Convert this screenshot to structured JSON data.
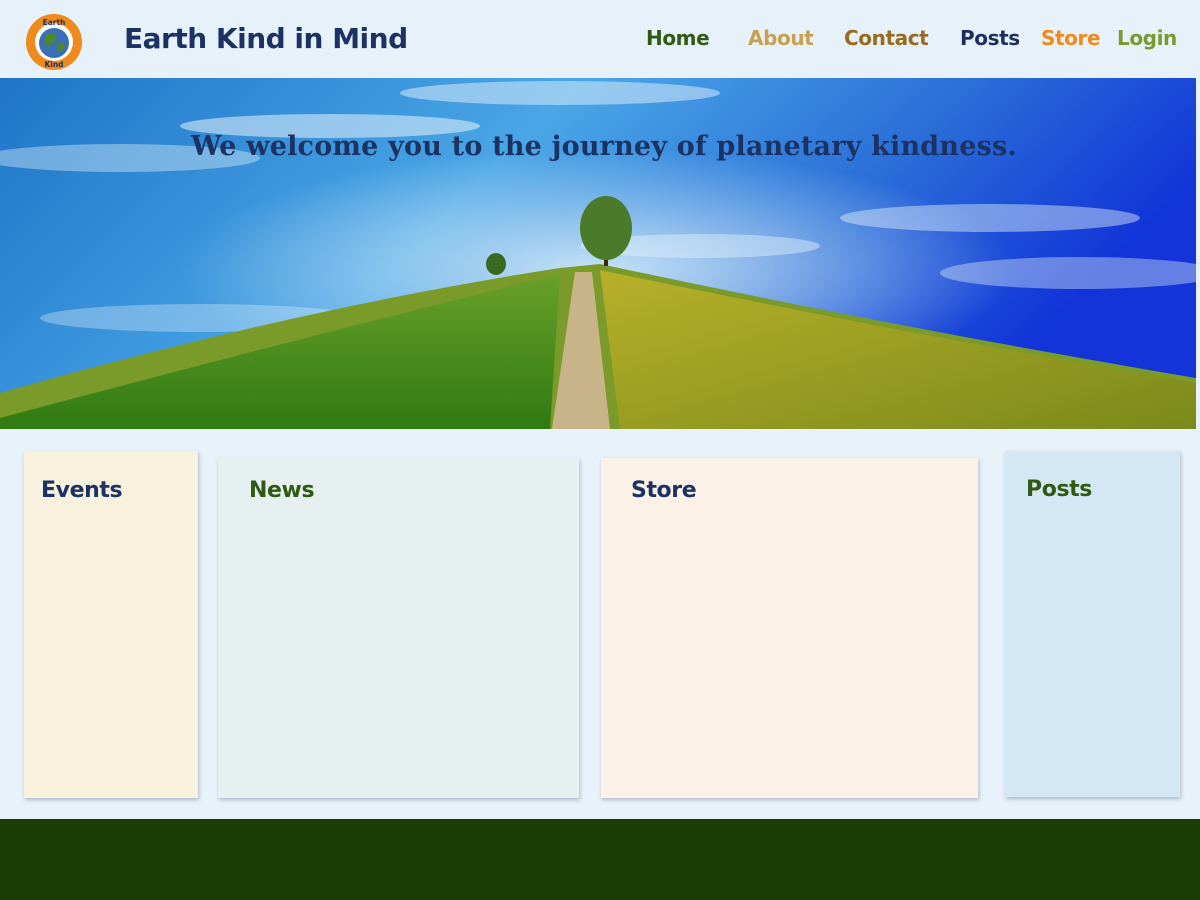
{
  "header": {
    "logo": {
      "top_text": "Earth",
      "bottom_text": "Kind"
    },
    "title": "Earth Kind in Mind",
    "nav": [
      {
        "label": "Home",
        "color": "#2f5a12"
      },
      {
        "label": "About",
        "color": "#c8a050"
      },
      {
        "label": "Contact",
        "color": "#9a6a1e"
      },
      {
        "label": "Posts",
        "color": "#1c2f5c"
      },
      {
        "label": "Store",
        "color": "#f08a1c"
      },
      {
        "label": "Login",
        "color": "#7a9a30"
      }
    ]
  },
  "hero": {
    "tagline": "We welcome you to the journey of planetary kindness."
  },
  "cards": [
    {
      "title": "Events",
      "bg": "#f7f1de",
      "title_color": "#1c3263"
    },
    {
      "title": "News",
      "bg": "#e6f0f0",
      "title_color": "#2f5a12"
    },
    {
      "title": "Store",
      "bg": "#fcf1e6",
      "title_color": "#1c3263"
    },
    {
      "title": "Posts",
      "bg": "#d4e7f4",
      "title_color": "#2f5a12"
    }
  ],
  "footer": {
    "bg": "#1a3d05"
  }
}
